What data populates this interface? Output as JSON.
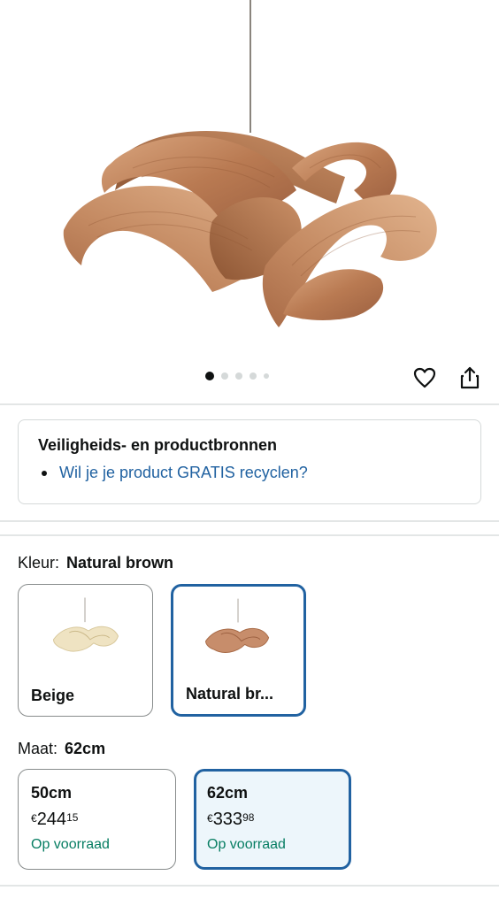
{
  "gallery": {
    "image_name": "wooden-ribbon-pendant-lamp",
    "dot_count": 5,
    "active_index": 0
  },
  "actions": {
    "favorite_icon": "heart-icon",
    "share_icon": "share-icon"
  },
  "safety": {
    "title": "Veiligheids- en productbronnen",
    "link": "Wil je je product GRATIS recyclen?"
  },
  "color": {
    "label": "Kleur:",
    "selected": "Natural brown",
    "options": [
      {
        "label": "Beige",
        "tone": "#efe3c2",
        "selected": false
      },
      {
        "label": "Natural br...",
        "tone": "#c78d6b",
        "selected": true
      }
    ]
  },
  "size": {
    "label": "Maat:",
    "selected": "62cm",
    "options": [
      {
        "label": "50cm",
        "currency": "€",
        "whole": "244",
        "fraction": "15",
        "stock": "Op voorraad",
        "selected": false
      },
      {
        "label": "62cm",
        "currency": "€",
        "whole": "333",
        "fraction": "98",
        "stock": "Op voorraad",
        "selected": true
      }
    ]
  },
  "colors": {
    "link": "#2162a1",
    "selected_border": "#2162a1",
    "in_stock": "#067d62",
    "wood": "#b5774f"
  }
}
